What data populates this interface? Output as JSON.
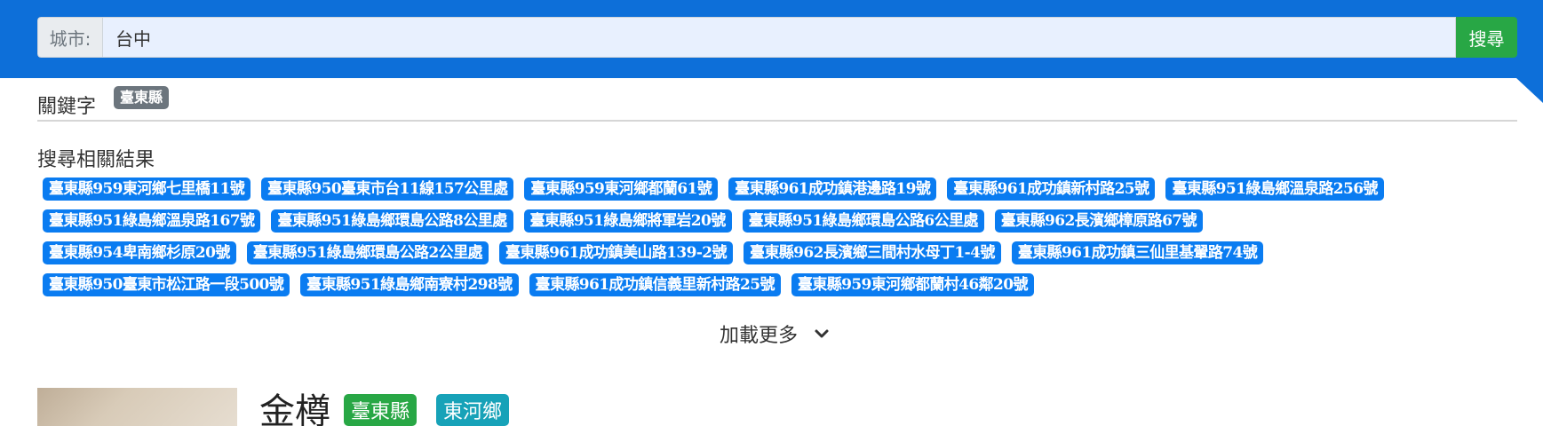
{
  "search": {
    "city_label": "城市:",
    "city_value": "台中",
    "button_label": "搜尋"
  },
  "keywords": {
    "label": "關鍵字",
    "tags": [
      "臺東縣"
    ]
  },
  "results": {
    "title": "搜尋相關結果",
    "rows": [
      [
        "臺東縣959東河鄉七里橋11號",
        "臺東縣950臺東市台11線157公里處",
        "臺東縣959東河鄉都蘭61號",
        "臺東縣961成功鎮港邊路19號",
        "臺東縣961成功鎮新村路25號",
        "臺東縣951綠島鄉溫泉路256號"
      ],
      [
        "臺東縣951綠島鄉溫泉路167號",
        "臺東縣951綠島鄉環島公路8公里處",
        "臺東縣951綠島鄉將軍岩20號",
        "臺東縣951綠島鄉環島公路6公里處",
        "臺東縣962長濱鄉樟原路67號"
      ],
      [
        "臺東縣954卑南鄉杉原20號",
        "臺東縣951綠島鄉環島公路2公里處",
        "臺東縣961成功鎮美山路139-2號",
        "臺東縣962長濱鄉三間村水母丁1-4號",
        "臺東縣961成功鎮三仙里基翬路74號"
      ],
      [
        "臺東縣950臺東市松江路一段500號",
        "臺東縣951綠島鄉南寮村298號",
        "臺東縣961成功鎮信義里新村路25號",
        "臺東縣959東河鄉都蘭村46鄰20號"
      ]
    ]
  },
  "load_more": {
    "label": "加載更多",
    "icon": "chevron-down-icon"
  },
  "card": {
    "title": "金樽",
    "county_badge": "臺東縣",
    "town_badge": "東河鄉"
  },
  "colors": {
    "header_blue": "#0d6fd9",
    "tag_blue": "#0a7cf1",
    "button_green": "#28a745",
    "badge_gray": "#6c757d",
    "badge_teal": "#17a2b8"
  }
}
